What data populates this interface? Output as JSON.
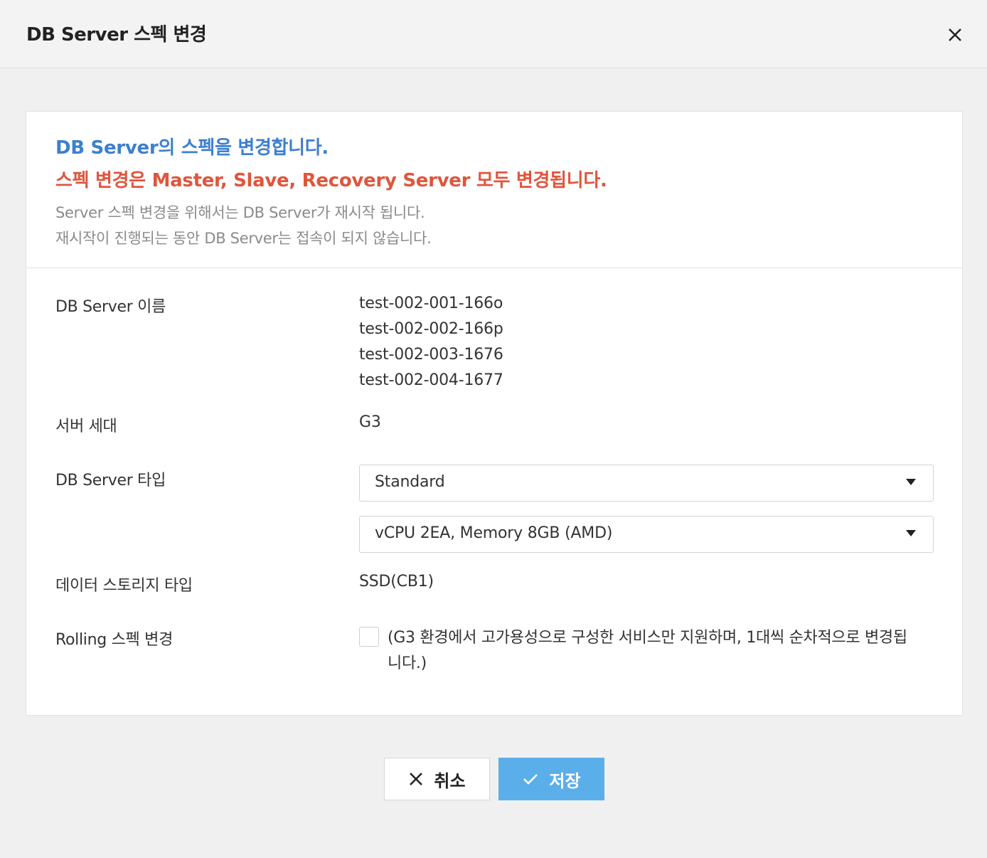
{
  "dialog": {
    "title": "DB Server 스펙 변경"
  },
  "notice": {
    "line1": "DB Server의 스펙을 변경합니다.",
    "line2": "스펙 변경은 Master, Slave, Recovery Server 모두 변경됩니다.",
    "line3": "Server 스펙 변경을 위해서는 DB Server가 재시작 됩니다.",
    "line4": "재시작이 진행되는 동안 DB Server는 접속이 되지 않습니다."
  },
  "form": {
    "server_name_label": "DB Server 이름",
    "server_names": [
      "test-002-001-166o",
      "test-002-002-166p",
      "test-002-003-1676",
      "test-002-004-1677"
    ],
    "generation_label": "서버 세대",
    "generation_value": "G3",
    "type_label": "DB Server 타입",
    "type_select_value": "Standard",
    "spec_select_value": "vCPU 2EA, Memory 8GB (AMD)",
    "storage_label": "데이터 스토리지 타입",
    "storage_value": "SSD(CB1)",
    "rolling_label": "Rolling 스펙 변경",
    "rolling_checked": false,
    "rolling_desc": "(G3 환경에서 고가용성으로 구성한 서비스만 지원하며, 1대씩 순차적으로 변경됩니다.)"
  },
  "buttons": {
    "cancel_label": "취소",
    "save_label": "저장"
  },
  "colors": {
    "info_blue": "#3d7fcf",
    "warning_red": "#e0553c",
    "primary_button": "#5aaeea"
  }
}
